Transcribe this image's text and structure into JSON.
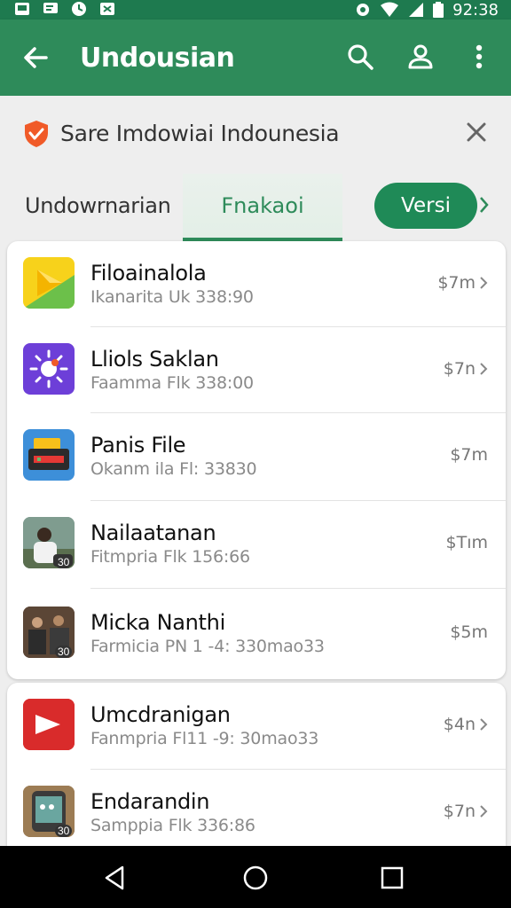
{
  "status_bar": {
    "time": "92:38",
    "left_icons": [
      "image-icon",
      "message-icon",
      "sync-icon",
      "download-icon"
    ],
    "right_icons": [
      "settings-icon",
      "wifi-icon",
      "signal-icon",
      "battery-icon"
    ]
  },
  "app_bar": {
    "title": "Undousian",
    "icons": [
      "back-arrow-icon",
      "search-icon",
      "account-icon",
      "more-vert-icon"
    ],
    "color": "#2e8b5a"
  },
  "search_banner": {
    "text": "Sare Imdowiai Indounesia",
    "icon": "shield-icon",
    "close_icon": "close-icon"
  },
  "tabs": {
    "tab1": "Undowrnarian",
    "tab2": "Fnakaoi",
    "tab3": "Versi",
    "active_color": "#2e8b5a"
  },
  "card1": {
    "rows": [
      {
        "name": "Filoainalola",
        "sub": "Ikanarita Uk 338:90",
        "size": "$7m",
        "chevron": true,
        "icon": "play-store-icon"
      },
      {
        "name": "Lliols Saklan",
        "sub": "Faamma Flk 338:00",
        "size": "$7n",
        "chevron": true,
        "icon": "sun-icon"
      },
      {
        "name": "Panis File",
        "sub": "Okanm ila Fl: 33830",
        "size": "$7m",
        "chevron": false,
        "icon": "file-manager-icon"
      },
      {
        "name": "Nailaatanan",
        "sub": "Fitmpria Flk 156:66",
        "size": "$Tım",
        "chevron": false,
        "icon": "person-photo-icon",
        "badge": "30"
      },
      {
        "name": "Micka Nanthi",
        "sub": "Farmicia PN 1 -4: 330mao33",
        "size": "$5m",
        "chevron": false,
        "icon": "group-photo-icon",
        "badge": "30"
      }
    ]
  },
  "card2": {
    "rows": [
      {
        "name": "Umcdranigan",
        "sub": "Fanmpria Fl11 -9: 30mao33",
        "size": "$4n",
        "chevron": true,
        "icon": "video-play-icon"
      },
      {
        "name": "Endarandin",
        "sub": "Samppia Flk 336:86",
        "size": "$7n",
        "chevron": true,
        "icon": "phone-app-icon",
        "badge": "30"
      }
    ]
  },
  "nav_bar": {
    "icons": [
      "back-triangle-icon",
      "home-circle-icon",
      "recents-square-icon"
    ]
  }
}
